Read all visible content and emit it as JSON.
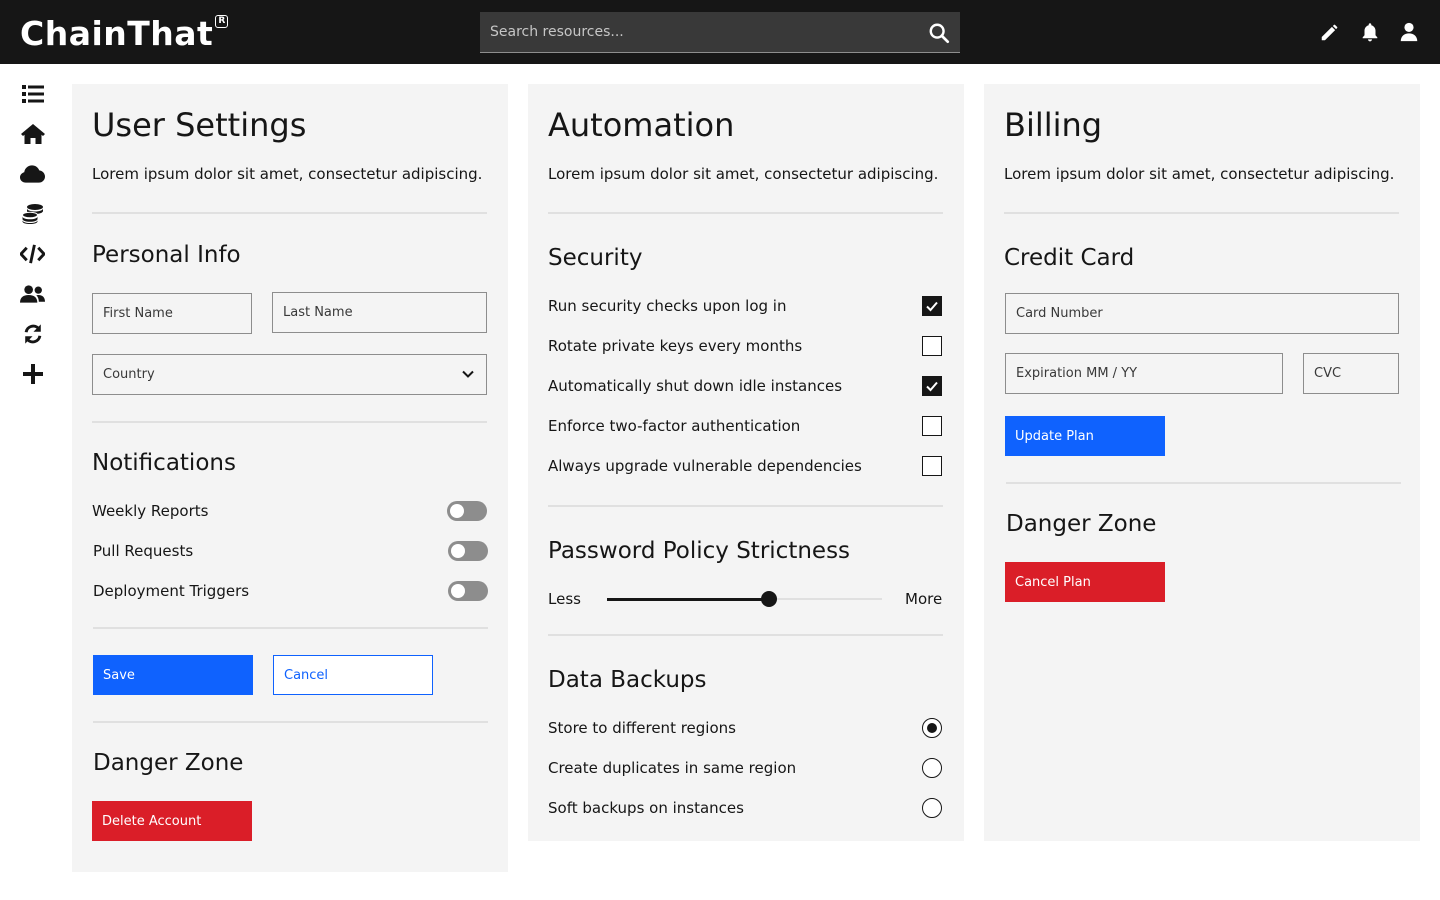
{
  "header": {
    "logo_text": "ChainThat",
    "logo_mark": "R",
    "search_placeholder": "Search resources...",
    "icons": [
      "search-icon",
      "pencil-icon",
      "bell-icon",
      "user-icon"
    ]
  },
  "sidenav": {
    "icons": [
      "list-icon",
      "home-icon",
      "cloud-icon",
      "coins-icon",
      "code-icon",
      "users-icon",
      "sync-icon",
      "plus-icon"
    ]
  },
  "user_settings": {
    "title": "User Settings",
    "description": "Lorem ipsum dolor sit amet, consectetur adipiscing.",
    "personal_info": {
      "heading": "Personal Info",
      "first_name_placeholder": "First Name",
      "last_name_placeholder": "Last Name",
      "country_placeholder": "Country"
    },
    "notifications": {
      "heading": "Notifications",
      "items": [
        {
          "label": "Weekly Reports",
          "enabled": false
        },
        {
          "label": "Pull Requests",
          "enabled": false
        },
        {
          "label": "Deployment Triggers",
          "enabled": false
        }
      ]
    },
    "save_label": "Save",
    "cancel_label": "Cancel",
    "danger_zone": {
      "heading": "Danger Zone",
      "delete_label": "Delete Account"
    }
  },
  "automation": {
    "title": "Automation",
    "description": "Lorem ipsum dolor sit amet, consectetur adipiscing.",
    "security": {
      "heading": "Security",
      "items": [
        {
          "label": "Run security checks upon log in",
          "checked": true
        },
        {
          "label": "Rotate private keys every months",
          "checked": false
        },
        {
          "label": "Automatically shut down idle instances",
          "checked": true
        },
        {
          "label": "Enforce two-factor authentication",
          "checked": false
        },
        {
          "label": "Always upgrade vulnerable dependencies",
          "checked": false
        }
      ]
    },
    "password_policy": {
      "heading": "Password Policy Strictness",
      "min_label": "Less",
      "max_label": "More",
      "value": 0.59
    },
    "backups": {
      "heading": "Data Backups",
      "options": [
        {
          "label": "Store to different regions",
          "selected": true
        },
        {
          "label": "Create duplicates in same region",
          "selected": false
        },
        {
          "label": "Soft backups on instances",
          "selected": false
        }
      ]
    }
  },
  "billing": {
    "title": "Billing",
    "description": "Lorem ipsum dolor sit amet, consectetur adipiscing.",
    "credit_card": {
      "heading": "Credit Card",
      "card_number_placeholder": "Card Number",
      "expiration_placeholder": "Expiration MM / YY",
      "cvc_placeholder": "CVC"
    },
    "update_plan_label": "Update Plan",
    "danger_zone": {
      "heading": "Danger Zone",
      "cancel_plan_label": "Cancel Plan"
    }
  },
  "colors": {
    "topbar": "#161616",
    "panel": "#f4f4f4",
    "primary": "#0f62fe",
    "danger": "#da1e28"
  }
}
